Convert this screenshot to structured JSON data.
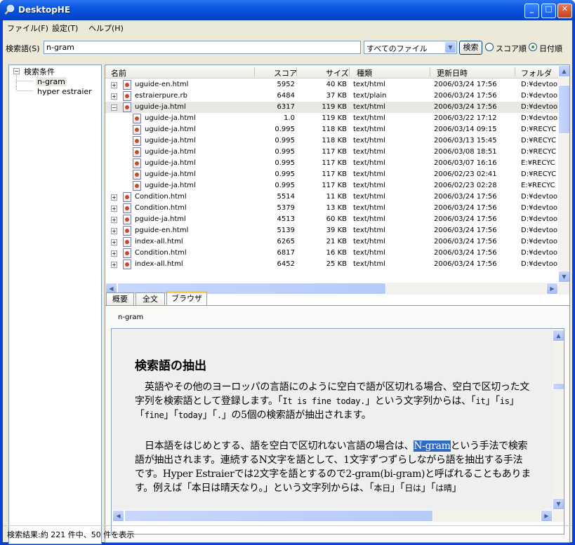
{
  "window": {
    "title": "DesktopHE",
    "min": "_",
    "max": "□",
    "close": "✕"
  },
  "menu": [
    "ファイル(F)",
    "設定(T)",
    "ヘルプ(H)"
  ],
  "search": {
    "label": "検索語(S)",
    "query": "n-gram",
    "filter": "すべてのファイル",
    "button": "検索",
    "sort_score": "スコア順",
    "sort_date": "日付順",
    "sort_selected": "日付順"
  },
  "tree": {
    "root": "検索条件",
    "items": [
      "n-gram",
      "hyper estraier"
    ]
  },
  "results": {
    "columns": [
      "名前",
      "スコア",
      "サイズ",
      "種類",
      "更新日時",
      "フォルダ"
    ],
    "rows": [
      {
        "exp": "+",
        "level": 0,
        "name": "uguide-en.html",
        "score": "5952",
        "size": "40 KB",
        "type": "text/html",
        "date": "2006/03/24 17:56",
        "folder": "D:¥devtool"
      },
      {
        "exp": "+",
        "level": 0,
        "name": "estraierpure.rb",
        "score": "6484",
        "size": "37 KB",
        "type": "text/plain",
        "date": "2006/03/24 17:56",
        "folder": "D:¥devtool"
      },
      {
        "exp": "−",
        "level": 0,
        "name": "uguide-ja.html",
        "score": "6317",
        "size": "119 KB",
        "type": "text/html",
        "date": "2006/03/24 17:56",
        "folder": "D:¥devtool"
      },
      {
        "exp": "",
        "level": 1,
        "name": "uguide-ja.html",
        "score": "1.0",
        "size": "119 KB",
        "type": "text/html",
        "date": "2006/03/22 17:12",
        "folder": "D:¥devtool"
      },
      {
        "exp": "",
        "level": 1,
        "name": "uguide-ja.html",
        "score": "0.995",
        "size": "118 KB",
        "type": "text/html",
        "date": "2006/03/14 09:15",
        "folder": "D:¥RECYC"
      },
      {
        "exp": "",
        "level": 1,
        "name": "uguide-ja.html",
        "score": "0.995",
        "size": "118 KB",
        "type": "text/html",
        "date": "2006/03/13 15:45",
        "folder": "D:¥RECYC"
      },
      {
        "exp": "",
        "level": 1,
        "name": "uguide-ja.html",
        "score": "0.995",
        "size": "117 KB",
        "type": "text/html",
        "date": "2006/03/08 18:51",
        "folder": "D:¥RECYC"
      },
      {
        "exp": "",
        "level": 1,
        "name": "uguide-ja.html",
        "score": "0.995",
        "size": "117 KB",
        "type": "text/html",
        "date": "2006/03/07 16:16",
        "folder": "E:¥RECYC"
      },
      {
        "exp": "",
        "level": 1,
        "name": "uguide-ja.html",
        "score": "0.995",
        "size": "117 KB",
        "type": "text/html",
        "date": "2006/02/23 02:41",
        "folder": "D:¥RECYC"
      },
      {
        "exp": "",
        "level": 1,
        "name": "uguide-ja.html",
        "score": "0.995",
        "size": "117 KB",
        "type": "text/html",
        "date": "2006/02/23 02:28",
        "folder": "E:¥RECYC"
      },
      {
        "exp": "+",
        "level": 0,
        "name": "Condition.html",
        "score": "5514",
        "size": "11 KB",
        "type": "text/html",
        "date": "2006/03/24 17:56",
        "folder": "D:¥devtool"
      },
      {
        "exp": "+",
        "level": 0,
        "name": "Condition.html",
        "score": "5379",
        "size": "13 KB",
        "type": "text/html",
        "date": "2006/03/24 17:56",
        "folder": "D:¥devtool"
      },
      {
        "exp": "+",
        "level": 0,
        "name": "pguide-ja.html",
        "score": "4513",
        "size": "60 KB",
        "type": "text/html",
        "date": "2006/03/24 17:56",
        "folder": "D:¥devtool"
      },
      {
        "exp": "+",
        "level": 0,
        "name": "pguide-en.html",
        "score": "5139",
        "size": "39 KB",
        "type": "text/html",
        "date": "2006/03/24 17:56",
        "folder": "D:¥devtool"
      },
      {
        "exp": "+",
        "level": 0,
        "name": "index-all.html",
        "score": "6265",
        "size": "21 KB",
        "type": "text/html",
        "date": "2006/03/24 17:56",
        "folder": "D:¥devtool"
      },
      {
        "exp": "+",
        "level": 0,
        "name": "Condition.html",
        "score": "6817",
        "size": "16 KB",
        "type": "text/html",
        "date": "2006/03/24 17:56",
        "folder": "D:¥devtool"
      },
      {
        "exp": "+",
        "level": 0,
        "name": "index-all.html",
        "score": "6452",
        "size": "25 KB",
        "type": "text/html",
        "date": "2006/03/24 17:56",
        "folder": "D:¥devtool"
      }
    ]
  },
  "tabs": [
    "概要",
    "全文",
    "ブラウザ"
  ],
  "active_tab": "ブラウザ",
  "browser": {
    "query_label": "n-gram",
    "heading": "検索語の抽出",
    "p1_a": "英語やその他のヨーロッパの言語にのように空白で語が区切れる場合、空白で区切った文字列を検索語として登録します。「",
    "p1_code": "It is fine today.",
    "p1_b": "」という文字列からは、「",
    "p1_t1": "it",
    "p1_s1": "」「",
    "p1_t2": "is",
    "p1_s2": "」「",
    "p1_t3": "fine",
    "p1_s3": "」「",
    "p1_t4": "today",
    "p1_s4": "」「",
    "p1_t5": ".",
    "p1_c": "」の5個の検索語が抽出されます。",
    "p2_a": "日本語をはじめとする、語を空白で区切れない言語の場合は、",
    "p2_hl": "N-gram",
    "p2_b": "という手法で検索語が抽出されます。連続するN文字を語として、1文字ずつずらしながら語を抽出する手法です。Hyper Estraierでは2文字を語とするので2-gram(bi-gram)と呼ばれることもあります。例えば「本日は晴天なり。」という文字列からは、「",
    "p2_t1": "本日",
    "p2_s1": "」「",
    "p2_t2": "日は",
    "p2_s2": "」「",
    "p2_t3": "は晴",
    "p2_c": "」"
  },
  "status": "検索結果:約 221 件中、50 件を表示"
}
